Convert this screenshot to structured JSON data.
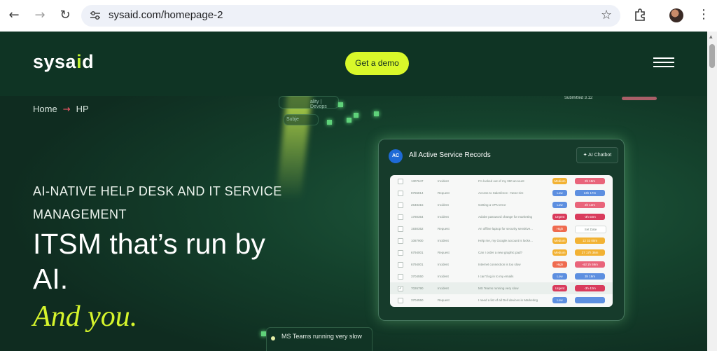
{
  "browser": {
    "url": "sysaid.com/homepage-2",
    "back_glyph": "←",
    "forward_glyph": "→",
    "reload_glyph": "↻",
    "star_glyph": "☆",
    "menu_glyph": "⋮"
  },
  "header": {
    "logo_text": "sysa",
    "logo_accent": "i",
    "logo_end": "d",
    "demo_label": "Get a demo"
  },
  "breadcrumb": {
    "home": "Home",
    "arrow": "→",
    "current": "HP"
  },
  "hero": {
    "eyebrow": "AI-NATIVE HELP DESK AND IT SERVICE MANAGEMENT",
    "headline": "ITSM that’s run by AI.",
    "italic": "And you."
  },
  "panel": {
    "logo": "AC",
    "title": "All Active Service Records",
    "chatbot_label": "✦ AI Chatbot",
    "rows": [
      {
        "id": "1307647",
        "type": "Incident",
        "desc": "I'm locked out of my 360 account",
        "priority": "Medium",
        "pcolor": "#f2b233",
        "sla": "2h 19m",
        "scolor": "#e9647a",
        "checked": ""
      },
      {
        "id": "8755814",
        "type": "Request",
        "desc": "Access to Salesforce - New Hire",
        "priority": "Low",
        "pcolor": "#5d8fe0",
        "sla": "24h 17m",
        "scolor": "#5d8fe0",
        "checked": ""
      },
      {
        "id": "2648315",
        "type": "Incident",
        "desc": "Getting a VPN error",
        "priority": "Low",
        "pcolor": "#5d8fe0",
        "sla": "2h 13m",
        "scolor": "#e9647a",
        "checked": ""
      },
      {
        "id": "1780354",
        "type": "Incident",
        "desc": "Adobe password change for marketing",
        "priority": "Urgent",
        "pcolor": "#d93b5c",
        "sla": "-3h 02m",
        "scolor": "#d93b5c",
        "checked": ""
      },
      {
        "id": "1930352",
        "type": "Request",
        "desc": "An offline laptop for security sensitive...",
        "priority": "High",
        "pcolor": "#ef6b4f",
        "sla": "Set Date",
        "scolor": "#ffffff",
        "checked": ""
      },
      {
        "id": "1087900",
        "type": "Incident",
        "desc": "Help me, my Google account is locke...",
        "priority": "Medium",
        "pcolor": "#f2b233",
        "sla": "12 33 00m",
        "scolor": "#f2b233",
        "checked": ""
      },
      {
        "id": "6794001",
        "type": "Request",
        "desc": "Can I order a new graphic pad?",
        "priority": "Medium",
        "pcolor": "#f2b233",
        "sla": "27 17h 36m",
        "scolor": "#f2b233",
        "checked": ""
      },
      {
        "id": "6794001",
        "type": "Incident",
        "desc": "Internet connection is too slow",
        "priority": "High",
        "pcolor": "#ef6b4f",
        "sla": "-4d 1h 59m",
        "scolor": "#e9647a",
        "checked": ""
      },
      {
        "id": "3704550",
        "type": "Incident",
        "desc": "I can't log in to my emails",
        "priority": "Low",
        "pcolor": "#5d8fe0",
        "sla": "3h 19m",
        "scolor": "#5d8fe0",
        "checked": ""
      },
      {
        "id": "7026790",
        "type": "Incident",
        "desc": "MS Teams running very slow",
        "priority": "Urgent",
        "pcolor": "#d93b5c",
        "sla": "-3h 42m",
        "scolor": "#d93b5c",
        "checked": "✓"
      },
      {
        "id": "3704550",
        "type": "Request",
        "desc": "I need a list of all Dell devices in Marketing",
        "priority": "Low",
        "pcolor": "#5d8fe0",
        "sla": "",
        "scolor": "#5d8fe0",
        "checked": ""
      }
    ]
  },
  "toast": {
    "text": "MS Teams running very slow"
  },
  "floating": {
    "submitted": "Submitted 3.12",
    "fragment_top": "ality | Devops",
    "fragment_left": "Subje"
  },
  "colors": {
    "accent": "#d9f82a",
    "brand_bg": "#0f2c20",
    "arrow": "#ff5a6a"
  }
}
